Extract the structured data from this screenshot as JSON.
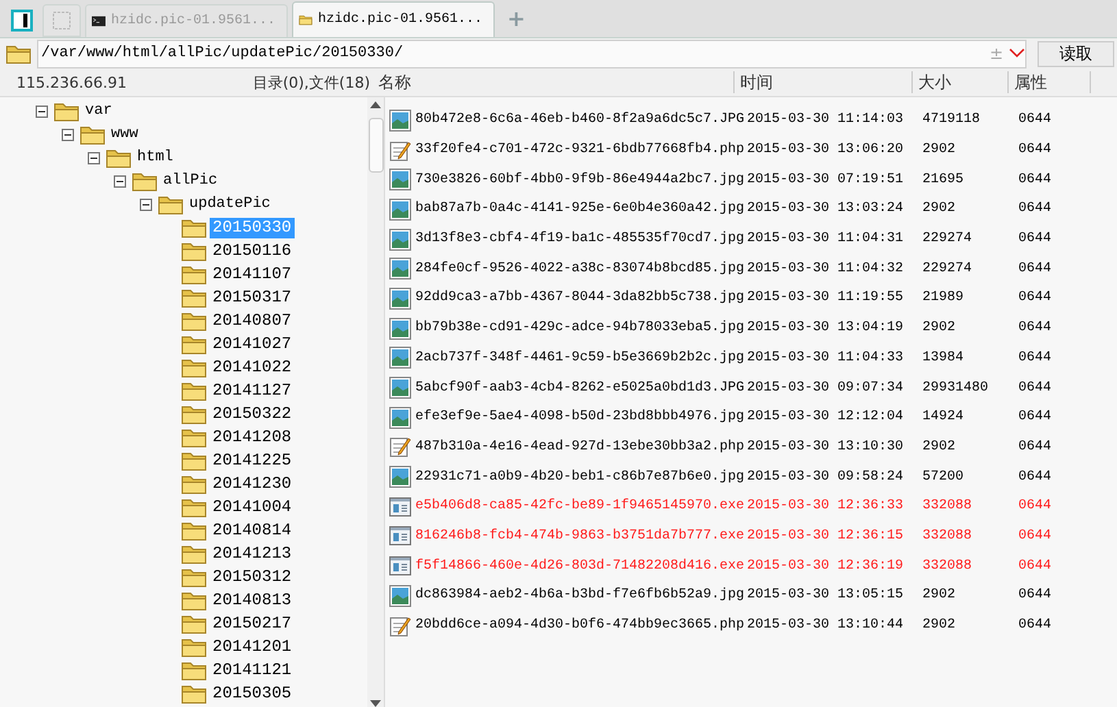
{
  "tabs": [
    {
      "kind": "toggle",
      "selected": false
    },
    {
      "kind": "blank",
      "selected": false
    },
    {
      "kind": "terminal",
      "label": "hzidc.pic-01.9561...",
      "selected": false
    },
    {
      "kind": "folder",
      "label": "hzidc.pic-01.9561...",
      "selected": true
    }
  ],
  "new_tab": "+",
  "address": {
    "value": "/var/www/html/allPic/updatePic/20150330/",
    "plus_minus": "±",
    "read_button": "读取"
  },
  "host": "115.236.66.91",
  "summary": "目录(0),文件(18)",
  "columns": [
    "名称",
    "时间",
    "大小",
    "属性"
  ],
  "tree": [
    {
      "label": "var",
      "expanded": true,
      "selected": false,
      "children": [
        {
          "label": "www",
          "expanded": true,
          "selected": false,
          "children": [
            {
              "label": "html",
              "expanded": true,
              "selected": false,
              "children": [
                {
                  "label": "allPic",
                  "expanded": true,
                  "selected": false,
                  "children": [
                    {
                      "label": "updatePic",
                      "expanded": true,
                      "selected": false,
                      "children": [
                        {
                          "label": "20150330",
                          "selected": true
                        },
                        {
                          "label": "20150116",
                          "selected": false
                        },
                        {
                          "label": "20141107",
                          "selected": false
                        },
                        {
                          "label": "20150317",
                          "selected": false
                        },
                        {
                          "label": "20140807",
                          "selected": false
                        },
                        {
                          "label": "20141027",
                          "selected": false
                        },
                        {
                          "label": "20141022",
                          "selected": false
                        },
                        {
                          "label": "20141127",
                          "selected": false
                        },
                        {
                          "label": "20150322",
                          "selected": false
                        },
                        {
                          "label": "20141208",
                          "selected": false
                        },
                        {
                          "label": "20141225",
                          "selected": false
                        },
                        {
                          "label": "20141230",
                          "selected": false
                        },
                        {
                          "label": "20141004",
                          "selected": false
                        },
                        {
                          "label": "20140814",
                          "selected": false
                        },
                        {
                          "label": "20141213",
                          "selected": false
                        },
                        {
                          "label": "20150312",
                          "selected": false
                        },
                        {
                          "label": "20140813",
                          "selected": false
                        },
                        {
                          "label": "20150217",
                          "selected": false
                        },
                        {
                          "label": "20141201",
                          "selected": false
                        },
                        {
                          "label": "20141121",
                          "selected": false
                        },
                        {
                          "label": "20150305",
                          "selected": false
                        }
                      ]
                    }
                  ]
                }
              ]
            }
          ]
        }
      ]
    }
  ],
  "files": [
    {
      "kind": "image",
      "name": "80b472e8-6c6a-46eb-b460-8f2a9a6dc5c7.JPG",
      "time": "2015-03-30 11:14:03",
      "size": "4719118",
      "attr": "0644",
      "flagged": false
    },
    {
      "kind": "script",
      "name": "33f20fe4-c701-472c-9321-6bdb77668fb4.php",
      "time": "2015-03-30 13:06:20",
      "size": "2902",
      "attr": "0644",
      "flagged": false
    },
    {
      "kind": "image",
      "name": "730e3826-60bf-4bb0-9f9b-86e4944a2bc7.jpg",
      "time": "2015-03-30 07:19:51",
      "size": "21695",
      "attr": "0644",
      "flagged": false
    },
    {
      "kind": "image",
      "name": "bab87a7b-0a4c-4141-925e-6e0b4e360a42.jpg",
      "time": "2015-03-30 13:03:24",
      "size": "2902",
      "attr": "0644",
      "flagged": false
    },
    {
      "kind": "image",
      "name": "3d13f8e3-cbf4-4f19-ba1c-485535f70cd7.jpg",
      "time": "2015-03-30 11:04:31",
      "size": "229274",
      "attr": "0644",
      "flagged": false
    },
    {
      "kind": "image",
      "name": "284fe0cf-9526-4022-a38c-83074b8bcd85.jpg",
      "time": "2015-03-30 11:04:32",
      "size": "229274",
      "attr": "0644",
      "flagged": false
    },
    {
      "kind": "image",
      "name": "92dd9ca3-a7bb-4367-8044-3da82bb5c738.jpg",
      "time": "2015-03-30 11:19:55",
      "size": "21989",
      "attr": "0644",
      "flagged": false
    },
    {
      "kind": "image",
      "name": "bb79b38e-cd91-429c-adce-94b78033eba5.jpg",
      "time": "2015-03-30 13:04:19",
      "size": "2902",
      "attr": "0644",
      "flagged": false
    },
    {
      "kind": "image",
      "name": "2acb737f-348f-4461-9c59-b5e3669b2b2c.jpg",
      "time": "2015-03-30 11:04:33",
      "size": "13984",
      "attr": "0644",
      "flagged": false
    },
    {
      "kind": "image",
      "name": "5abcf90f-aab3-4cb4-8262-e5025a0bd1d3.JPG",
      "time": "2015-03-30 09:07:34",
      "size": "29931480",
      "attr": "0644",
      "flagged": false
    },
    {
      "kind": "image",
      "name": "efe3ef9e-5ae4-4098-b50d-23bd8bbb4976.jpg",
      "time": "2015-03-30 12:12:04",
      "size": "14924",
      "attr": "0644",
      "flagged": false
    },
    {
      "kind": "script",
      "name": "487b310a-4e16-4ead-927d-13ebe30bb3a2.php",
      "time": "2015-03-30 13:10:30",
      "size": "2902",
      "attr": "0644",
      "flagged": false
    },
    {
      "kind": "image",
      "name": "22931c71-a0b9-4b20-beb1-c86b7e87b6e0.jpg",
      "time": "2015-03-30 09:58:24",
      "size": "57200",
      "attr": "0644",
      "flagged": false
    },
    {
      "kind": "program",
      "name": "e5b406d8-ca85-42fc-be89-1f9465145970.exe",
      "time": "2015-03-30 12:36:33",
      "size": "332088",
      "attr": "0644",
      "flagged": true
    },
    {
      "kind": "program",
      "name": "816246b8-fcb4-474b-9863-b3751da7b777.exe",
      "time": "2015-03-30 12:36:15",
      "size": "332088",
      "attr": "0644",
      "flagged": true
    },
    {
      "kind": "program",
      "name": "f5f14866-460e-4d26-803d-71482208d416.exe",
      "time": "2015-03-30 12:36:19",
      "size": "332088",
      "attr": "0644",
      "flagged": true
    },
    {
      "kind": "image",
      "name": "dc863984-aeb2-4b6a-b3bd-f7e6fb6b52a9.jpg",
      "time": "2015-03-30 13:05:15",
      "size": "2902",
      "attr": "0644",
      "flagged": false
    },
    {
      "kind": "script",
      "name": "20bdd6ce-a094-4d30-b0f6-474bb9ec3665.php",
      "time": "2015-03-30 13:10:44",
      "size": "2902",
      "attr": "0644",
      "flagged": false
    }
  ]
}
